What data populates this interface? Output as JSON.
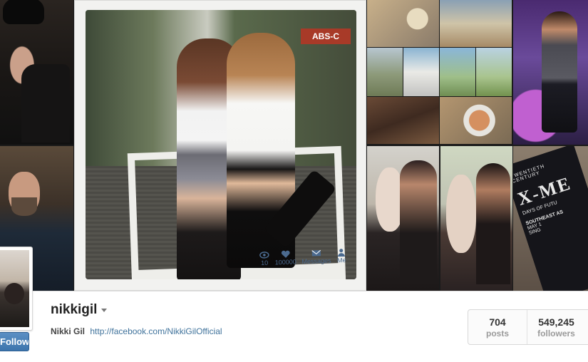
{
  "main_photo": {
    "sign_text": "ABS-C",
    "polaroid_bar": {
      "views": "10",
      "likes": "100000",
      "messages_label": "Messages",
      "me_label": "Me"
    }
  },
  "poster": {
    "line1": "TWENTIETH CENTURY",
    "line2": "X-ME",
    "line3": "DAYS OF FUTU",
    "line4": "SOUTHEAST AS",
    "line5": "MAY 1",
    "line6": "SING"
  },
  "profile": {
    "username": "nikkigil",
    "full_name": "Nikki Gil",
    "website": "http://facebook.com/NikkiGilOfficial",
    "follow_button_label": "Follow"
  },
  "stats": {
    "posts_count": "704",
    "posts_label": "posts",
    "followers_count": "549,245",
    "followers_label": "followers"
  },
  "colors": {
    "link": "#3f729b",
    "follow_button": "#3d75ad"
  }
}
